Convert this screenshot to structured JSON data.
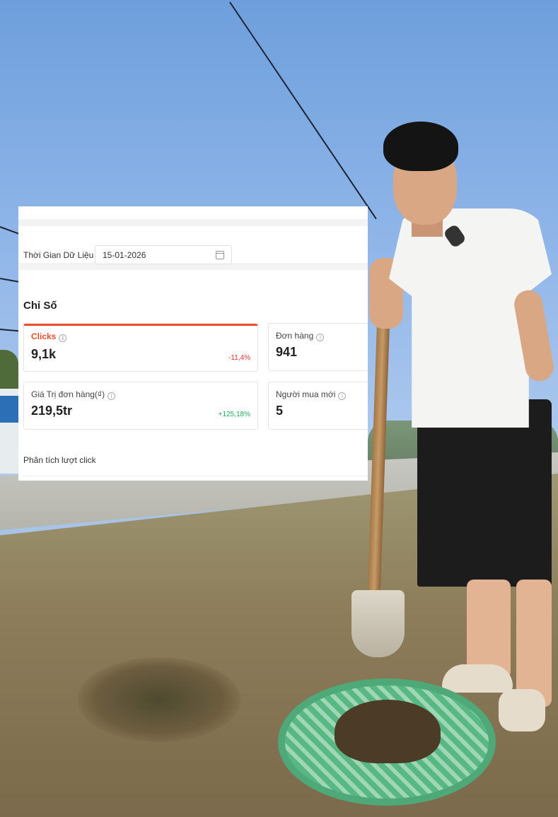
{
  "filter": {
    "label": "Thời Gian Dữ Liệu",
    "date_value": "15-01-2026",
    "icon": "calendar-icon"
  },
  "metrics": {
    "section_title": "Chỉ Số",
    "info_glyph": "i",
    "cards": [
      {
        "label": "Clicks",
        "value": "9,1k",
        "delta": "-11,4%"
      },
      {
        "label": "Đơn hàng",
        "value": "941"
      },
      {
        "label": "Giá Trị đơn hàng(₫)",
        "value": "219,5tr",
        "delta": "+125,18%"
      },
      {
        "label": "Người mua mới",
        "value": "5"
      }
    ]
  },
  "chart": {
    "title": "Phân tích lượt click"
  },
  "colors": {
    "accent": "#ee4d2d",
    "negative": "#e5302a",
    "positive": "#26aa5c"
  }
}
